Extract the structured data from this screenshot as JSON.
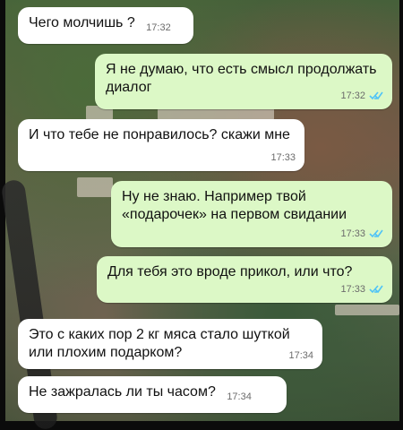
{
  "messages": [
    {
      "text": "Чего молчишь ?",
      "time": "17:32"
    },
    {
      "text": "Я не думаю, что есть смысл продолжать диалог",
      "time": "17:32",
      "read_icon": "double-check-icon"
    },
    {
      "text": "И что тебе не понравилось? скажи мне",
      "time": "17:33"
    },
    {
      "text": "Ну не знаю. Например твой «подарочек» на первом свидании",
      "time": "17:33",
      "read_icon": "double-check-icon"
    },
    {
      "text": "Для тебя это вроде прикол, или что?",
      "time": "17:33",
      "read_icon": "double-check-icon"
    },
    {
      "text": "Это с каких пор 2 кг мяса стало шуткой или плохим подарком?",
      "time": "17:34"
    },
    {
      "text": "Не зажралась ли ты часом?",
      "time": "17:34"
    }
  ],
  "colors": {
    "incoming_bubble": "#ffffff",
    "outgoing_bubble": "#dcf8c6",
    "read_ticks": "#4fc3f7",
    "time_text": "#6b6b6b"
  }
}
